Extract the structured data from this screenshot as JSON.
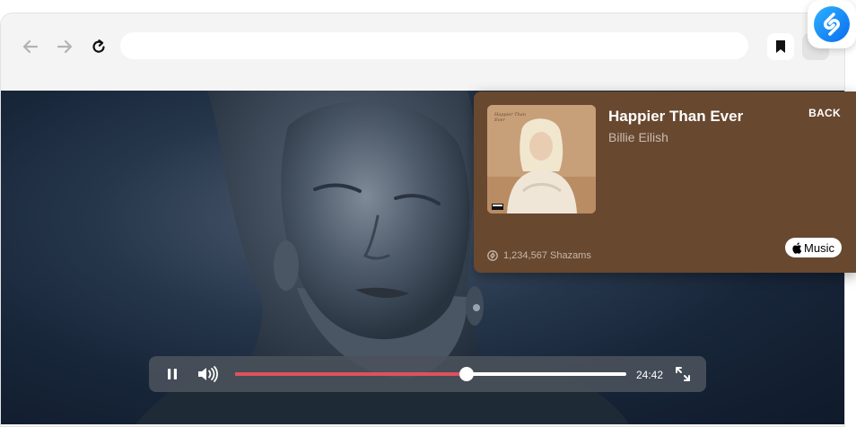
{
  "browser": {
    "back_icon": "arrow-left-icon",
    "forward_icon": "arrow-right-icon",
    "reload_icon": "reload-icon",
    "url": "",
    "bookmark_icon": "bookmark-icon"
  },
  "extension": {
    "icon": "shazam-icon",
    "accent": "#1a8cff"
  },
  "now_playing": {
    "title": "Happier Than Ever",
    "artist": "Billie Eilish",
    "back_label": "BACK",
    "shazam_count": "1,234,567 Shazams",
    "apple_music_label": "Music",
    "album_art_script": "Happier Than Ever",
    "card_color": "#68482f"
  },
  "player": {
    "time": "24:42",
    "progress_fraction": 0.591,
    "progress_color": "#e0505e",
    "play_state_icon": "pause-icon",
    "volume_icon": "volume-icon",
    "fullscreen_icon": "fullscreen-icon"
  }
}
